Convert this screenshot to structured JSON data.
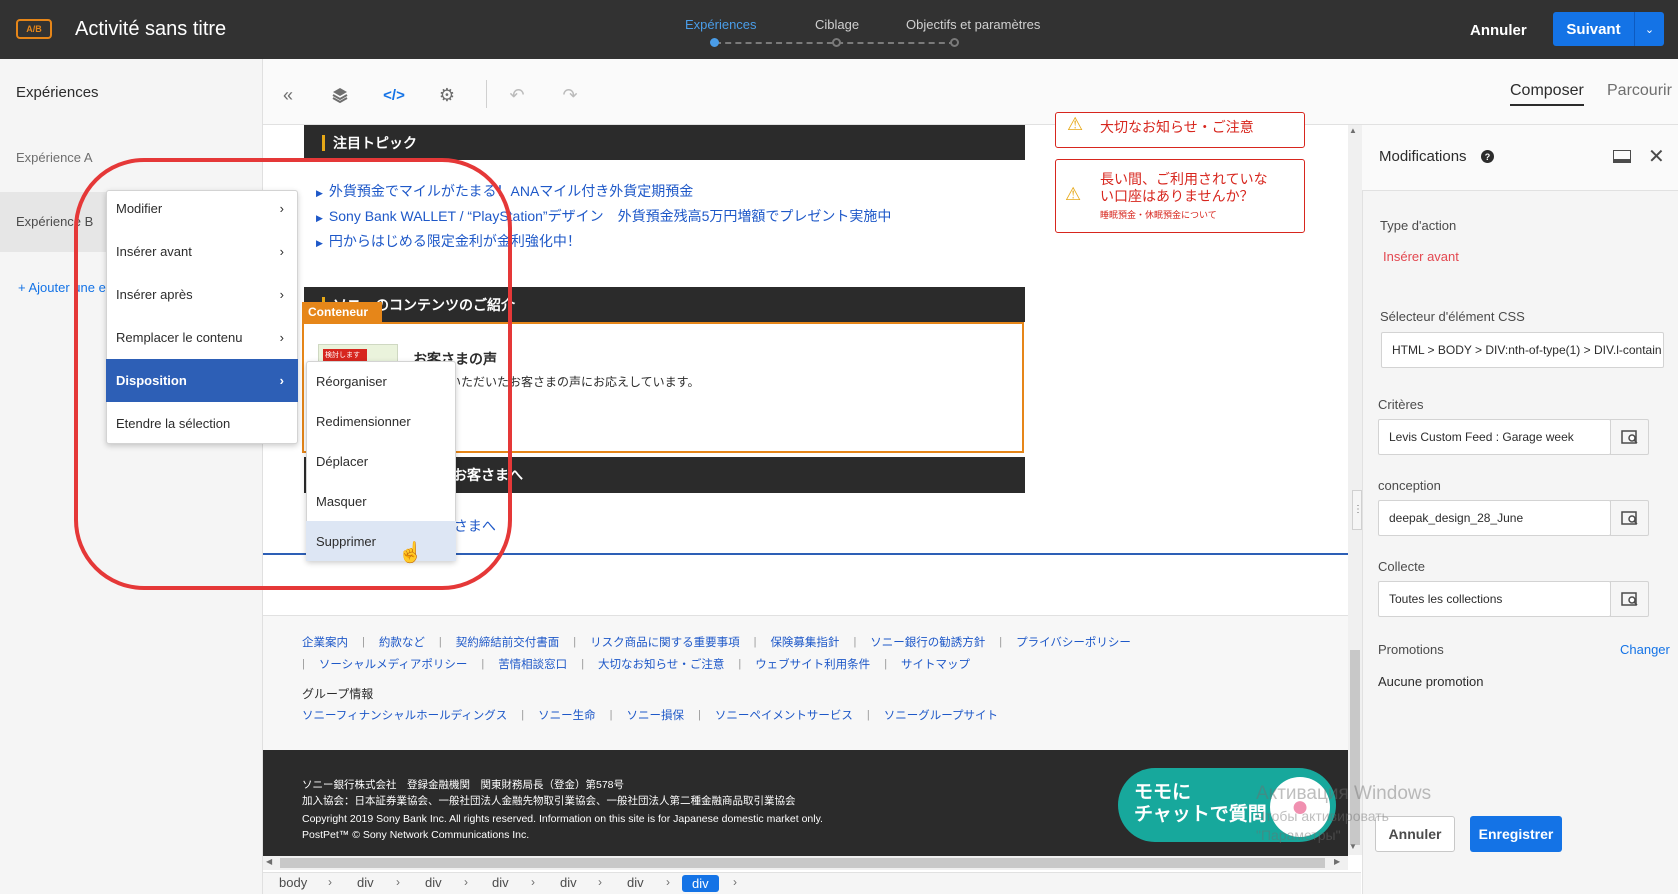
{
  "topbar": {
    "badge": "A/B",
    "title": "Activité sans titre",
    "steps": [
      {
        "label": "Expériences",
        "active": true
      },
      {
        "label": "Ciblage",
        "active": false
      },
      {
        "label": "Objectifs et paramètres",
        "active": false
      }
    ],
    "cancel": "Annuler",
    "next": "Suivant",
    "next_caret": "⌄"
  },
  "left": {
    "title": "Expériences",
    "experience_a": "Expérience A",
    "experience_b": "Expérience B",
    "add_experience": "+ Ajouter une e"
  },
  "toolbar": {
    "icons": [
      "double-chevron-left-icon",
      "layers-icon",
      "code-icon",
      "gear-icon",
      "undo-icon",
      "redo-icon"
    ],
    "tab_compose": "Composer",
    "tab_browse": "Parcourir"
  },
  "page": {
    "topic_header": "注目トピック",
    "topic_links": [
      "外貨預金でマイルがたまる！ANAマイル付き外貨定期預金",
      "Sony Bank WALLET / “PlayStation”デザイン　外貨預金残高5万円増額でプレゼント実施中",
      "円からはじめる限定金利が金利強化中！"
    ],
    "alert_top": "大切なお知らせ・ご注意",
    "alert_title": "長い間、ご利用されていない口座はありませんか？",
    "alert_sub": "睡眠預金・休眠預金について",
    "content_header": "ソニーのコンテンツのご紹介",
    "container_tag": "Conteneur",
    "thumb_label": "検討します",
    "voice_title": "お客さまの声",
    "voice_text": "お寄せいただいたお客さまの声にお応えしています。",
    "customers_header": "お客さまへ",
    "customers_link": "お客さまへ",
    "footer_links_row1": [
      "企業案内",
      "約款など",
      "契約締結前交付書面",
      "リスク商品に関する重要事項",
      "保険募集指針",
      "ソニー銀行の勧誘方針",
      "プライバシーポリシー"
    ],
    "footer_links_row2": [
      "ソーシャルメディアポリシー",
      "苦情相談窓口",
      "大切なお知らせ・ご注意",
      "ウェブサイト利用条件",
      "サイトマップ"
    ],
    "group_title": "グループ情報",
    "group_links": [
      "ソニーフィナンシャルホールディングス",
      "ソニー生命",
      "ソニー損保",
      "ソニーペイメントサービス",
      "ソニーグループサイト"
    ],
    "legal1": "ソニー銀行株式会社　登録金融機関　関東財務局長（登金）第578号",
    "legal2": "加入協会：日本証券業協会、一般社団法人金融先物取引業協会、一般社団法人第二種金融商品取引業協会",
    "copyright": "Copyright 2019 Sony Bank Inc. All rights reserved. Information on this site is for Japanese domestic market only.",
    "postpet": "PostPet™ © Sony Network Communications Inc.",
    "chat_line1": "モモに",
    "chat_line2": "チャットで質問"
  },
  "context_menu": {
    "items": [
      "Modifier",
      "Insérer avant",
      "Insérer après",
      "Remplacer le contenu",
      "Disposition",
      "Etendre la sélection"
    ],
    "selected": "Disposition",
    "submenu": [
      "Réorganiser",
      "Redimensionner",
      "Déplacer",
      "Masquer",
      "Supprimer"
    ],
    "submenu_hover": "Supprimer"
  },
  "breadcrumb": [
    "body",
    "div",
    "div",
    "div",
    "div",
    "div",
    "div"
  ],
  "right": {
    "title": "Modifications",
    "action_type_label": "Type d'action",
    "action_type_value": "Insérer avant",
    "css_label": "Sélecteur d'élément CSS",
    "css_value": "HTML > BODY > DIV:nth-of-type(1) > DIV.l-contain",
    "criteria_label": "Critères",
    "criteria_value": "Levis Custom Feed : Garage week",
    "design_label": "conception",
    "design_value": "deepak_design_28_June",
    "collection_label": "Collecte",
    "collection_value": "Toutes les collections",
    "promotions_label": "Promotions",
    "promotions_change": "Changer",
    "promotions_value": "Aucune promotion",
    "cancel": "Annuler",
    "save": "Enregistrer"
  },
  "watermark": {
    "line1": "Активация Windows",
    "line2": "Чтобы активировать",
    "line3": "\"Параметры\""
  },
  "colors": {
    "accent": "#1473e6",
    "annotation": "#e53838",
    "orange": "#e68619"
  }
}
